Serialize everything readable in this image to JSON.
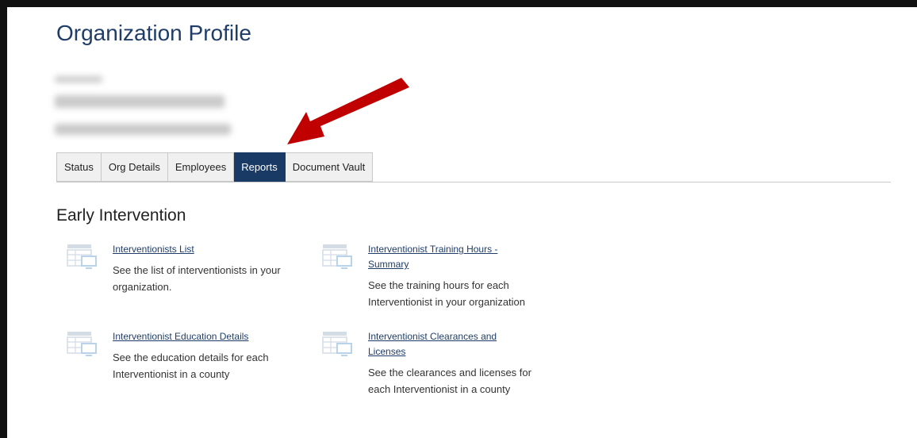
{
  "page": {
    "title": "Organization Profile"
  },
  "tabs": [
    {
      "label": "Status",
      "active": false
    },
    {
      "label": "Org Details",
      "active": false
    },
    {
      "label": "Employees",
      "active": false
    },
    {
      "label": "Reports",
      "active": true
    },
    {
      "label": "Document Vault",
      "active": false
    }
  ],
  "section": {
    "title": "Early Intervention"
  },
  "reports": [
    {
      "link": "Interventionists List",
      "description": "See the list of interventionists in your organization.",
      "icon": "table-monitor-icon"
    },
    {
      "link": "Interventionist Training Hours - Summary",
      "description": "See the training hours for each Interventionist in your organization",
      "icon": "table-monitor-icon"
    },
    {
      "link": "Interventionist Education Details",
      "description": "See the education details for each Interventionist in a county",
      "icon": "table-monitor-icon"
    },
    {
      "link": "Interventionist Clearances and Licenses",
      "description": "See the clearances and licenses for each Interventionist in a county",
      "icon": "table-monitor-icon"
    }
  ],
  "colors": {
    "brand": "#1f3d68",
    "tab_active": "#1a3a66",
    "annotation_arrow": "#c00000"
  }
}
